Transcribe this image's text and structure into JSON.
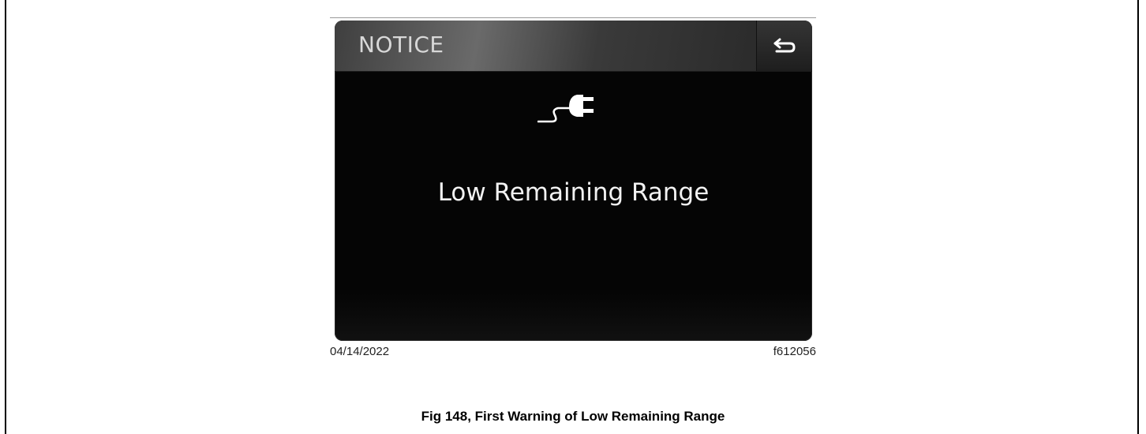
{
  "screen": {
    "header_title": "NOTICE",
    "back_icon": "back-arrow-icon",
    "status_icon": "charging-plug-icon",
    "message": "Low Remaining Range"
  },
  "figure": {
    "date": "04/14/2022",
    "ref": "f612056",
    "caption": "Fig 148, First Warning of Low Remaining Range"
  },
  "colors": {
    "screen_bg": "#050505",
    "header_bg": "#4a4a4a",
    "text": "#f2f2f2"
  }
}
